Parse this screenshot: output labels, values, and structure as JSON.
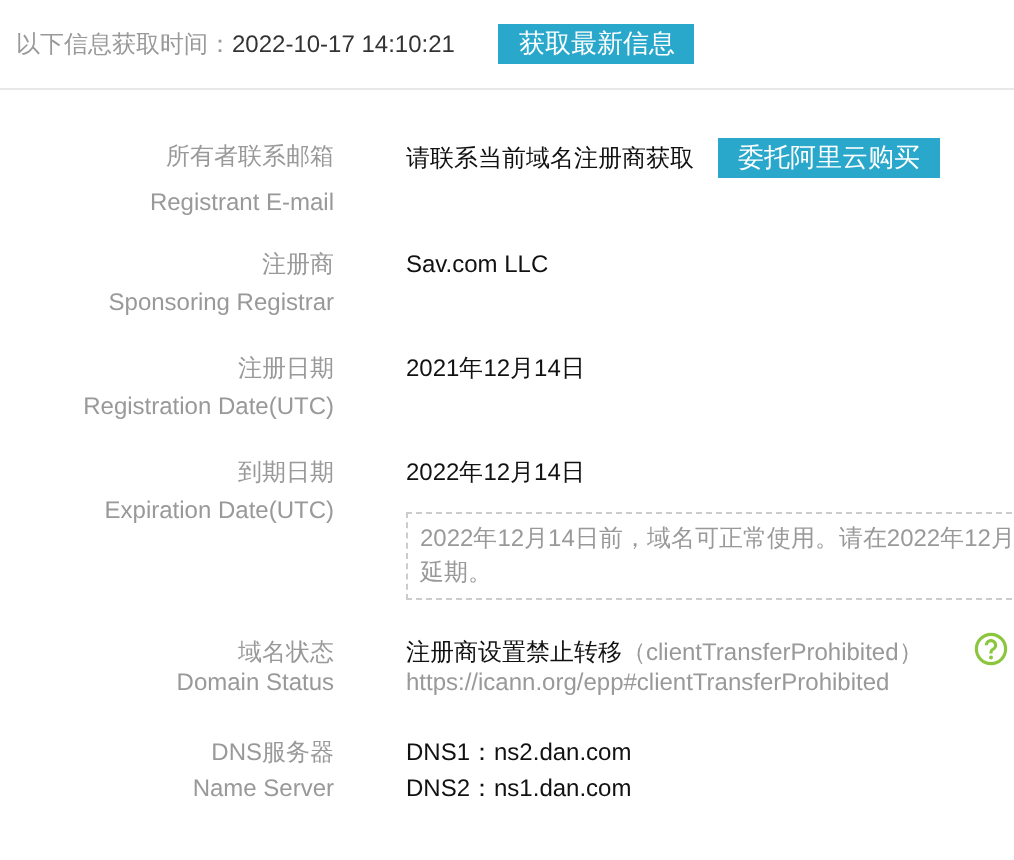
{
  "header": {
    "label": "以下信息获取时间：",
    "time": "2022-10-17 14:10:21",
    "button": "获取最新信息"
  },
  "fields": [
    {
      "kind": "email",
      "label": "所有者联系邮箱",
      "label_en": "Registrant E-mail",
      "value": "请联系当前域名注册商获取",
      "button": "委托阿里云购买"
    },
    {
      "kind": "text",
      "label": "注册商",
      "label_en": "Sponsoring Registrar",
      "value": "Sav.com LLC"
    },
    {
      "kind": "text",
      "label": "注册日期",
      "label_en": "Registration Date(UTC)",
      "value": "2021年12月14日"
    },
    {
      "kind": "date",
      "label": "到期日期",
      "label_en": "Expiration Date(UTC)",
      "value": "2022年12月14日",
      "notice": [
        "2022年12月14日前，域名可正常使用。请在2022年12月",
        "延期。"
      ]
    },
    {
      "kind": "status",
      "label": "域名状态",
      "label_en": "Domain Status",
      "value": "注册商设置禁止转移",
      "code": "（clientTransferProhibited）",
      "url": "https://icann.org/epp#clientTransferProhibited"
    },
    {
      "kind": "list",
      "label": "DNS服务器",
      "label_en": "Name Server",
      "lines": [
        "DNS1：ns2.dan.com",
        "DNS2：ns1.dan.com"
      ]
    }
  ]
}
